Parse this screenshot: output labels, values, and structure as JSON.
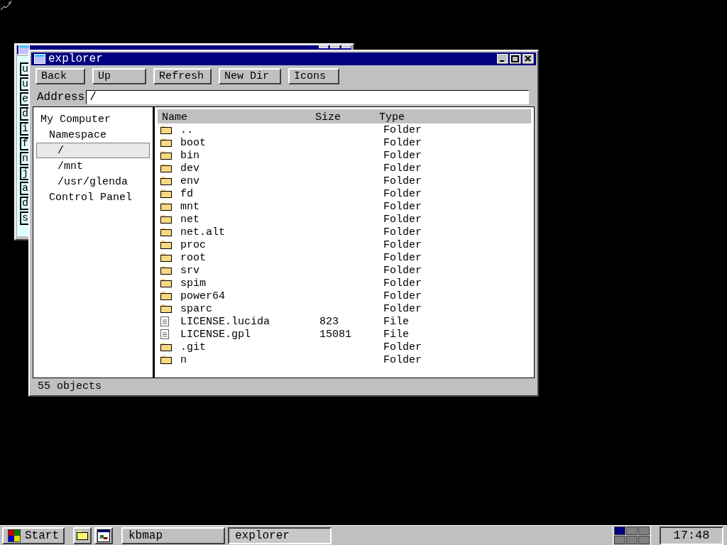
{
  "kbmap_window": {
    "keys": [
      "u",
      "u",
      "e",
      "d",
      "i",
      "f",
      "n",
      "j",
      "a",
      "d",
      "s"
    ]
  },
  "explorer": {
    "title": "explorer",
    "toolbar": [
      "Back",
      "Up",
      "Refresh",
      "New Dir",
      "Icons"
    ],
    "address": {
      "label": "Address",
      "value": "/"
    },
    "tree": [
      {
        "label": "My Computer",
        "selected": false,
        "children": [
          {
            "label": "Namespace",
            "selected": false,
            "children": [
              {
                "label": "/",
                "selected": true
              },
              {
                "label": "/mnt",
                "selected": false
              },
              {
                "label": "/usr/glenda",
                "selected": false
              }
            ]
          },
          {
            "label": "Control Panel",
            "selected": false
          }
        ]
      }
    ],
    "columns": [
      "Name",
      "Size",
      "Type"
    ],
    "rows": [
      {
        "kind": "folder",
        "name": "..",
        "type": "Folder"
      },
      {
        "kind": "folder",
        "name": "boot",
        "type": "Folder"
      },
      {
        "kind": "folder",
        "name": "bin",
        "type": "Folder"
      },
      {
        "kind": "folder",
        "name": "dev",
        "type": "Folder"
      },
      {
        "kind": "folder",
        "name": "env",
        "type": "Folder"
      },
      {
        "kind": "folder",
        "name": "fd",
        "type": "Folder"
      },
      {
        "kind": "folder",
        "name": "mnt",
        "type": "Folder"
      },
      {
        "kind": "folder",
        "name": "net",
        "type": "Folder"
      },
      {
        "kind": "folder",
        "name": "net.alt",
        "type": "Folder"
      },
      {
        "kind": "folder",
        "name": "proc",
        "type": "Folder"
      },
      {
        "kind": "folder",
        "name": "root",
        "type": "Folder"
      },
      {
        "kind": "folder",
        "name": "srv",
        "type": "Folder"
      },
      {
        "kind": "folder",
        "name": "spim",
        "type": "Folder"
      },
      {
        "kind": "folder",
        "name": "power64",
        "type": "Folder"
      },
      {
        "kind": "folder",
        "name": "sparc",
        "type": "Folder"
      },
      {
        "kind": "file",
        "name": "LICENSE.lucida",
        "size": "823",
        "type": "File"
      },
      {
        "kind": "file",
        "name": "LICENSE.gpl",
        "size": "15081",
        "type": "File"
      },
      {
        "kind": "folder",
        "name": ".git",
        "type": "Folder"
      },
      {
        "kind": "folder",
        "name": "n",
        "type": "Folder"
      }
    ],
    "status": "55 objects"
  },
  "taskbar": {
    "start": "Start",
    "tasks": [
      {
        "label": "kbmap",
        "selected": false
      },
      {
        "label": "explorer",
        "selected": true
      }
    ],
    "desktops": [
      {
        "selected": true
      },
      {
        "selected": false
      },
      {
        "selected": false
      },
      {
        "selected": false
      },
      {
        "selected": false
      },
      {
        "selected": false
      }
    ],
    "clock": "17:48"
  }
}
